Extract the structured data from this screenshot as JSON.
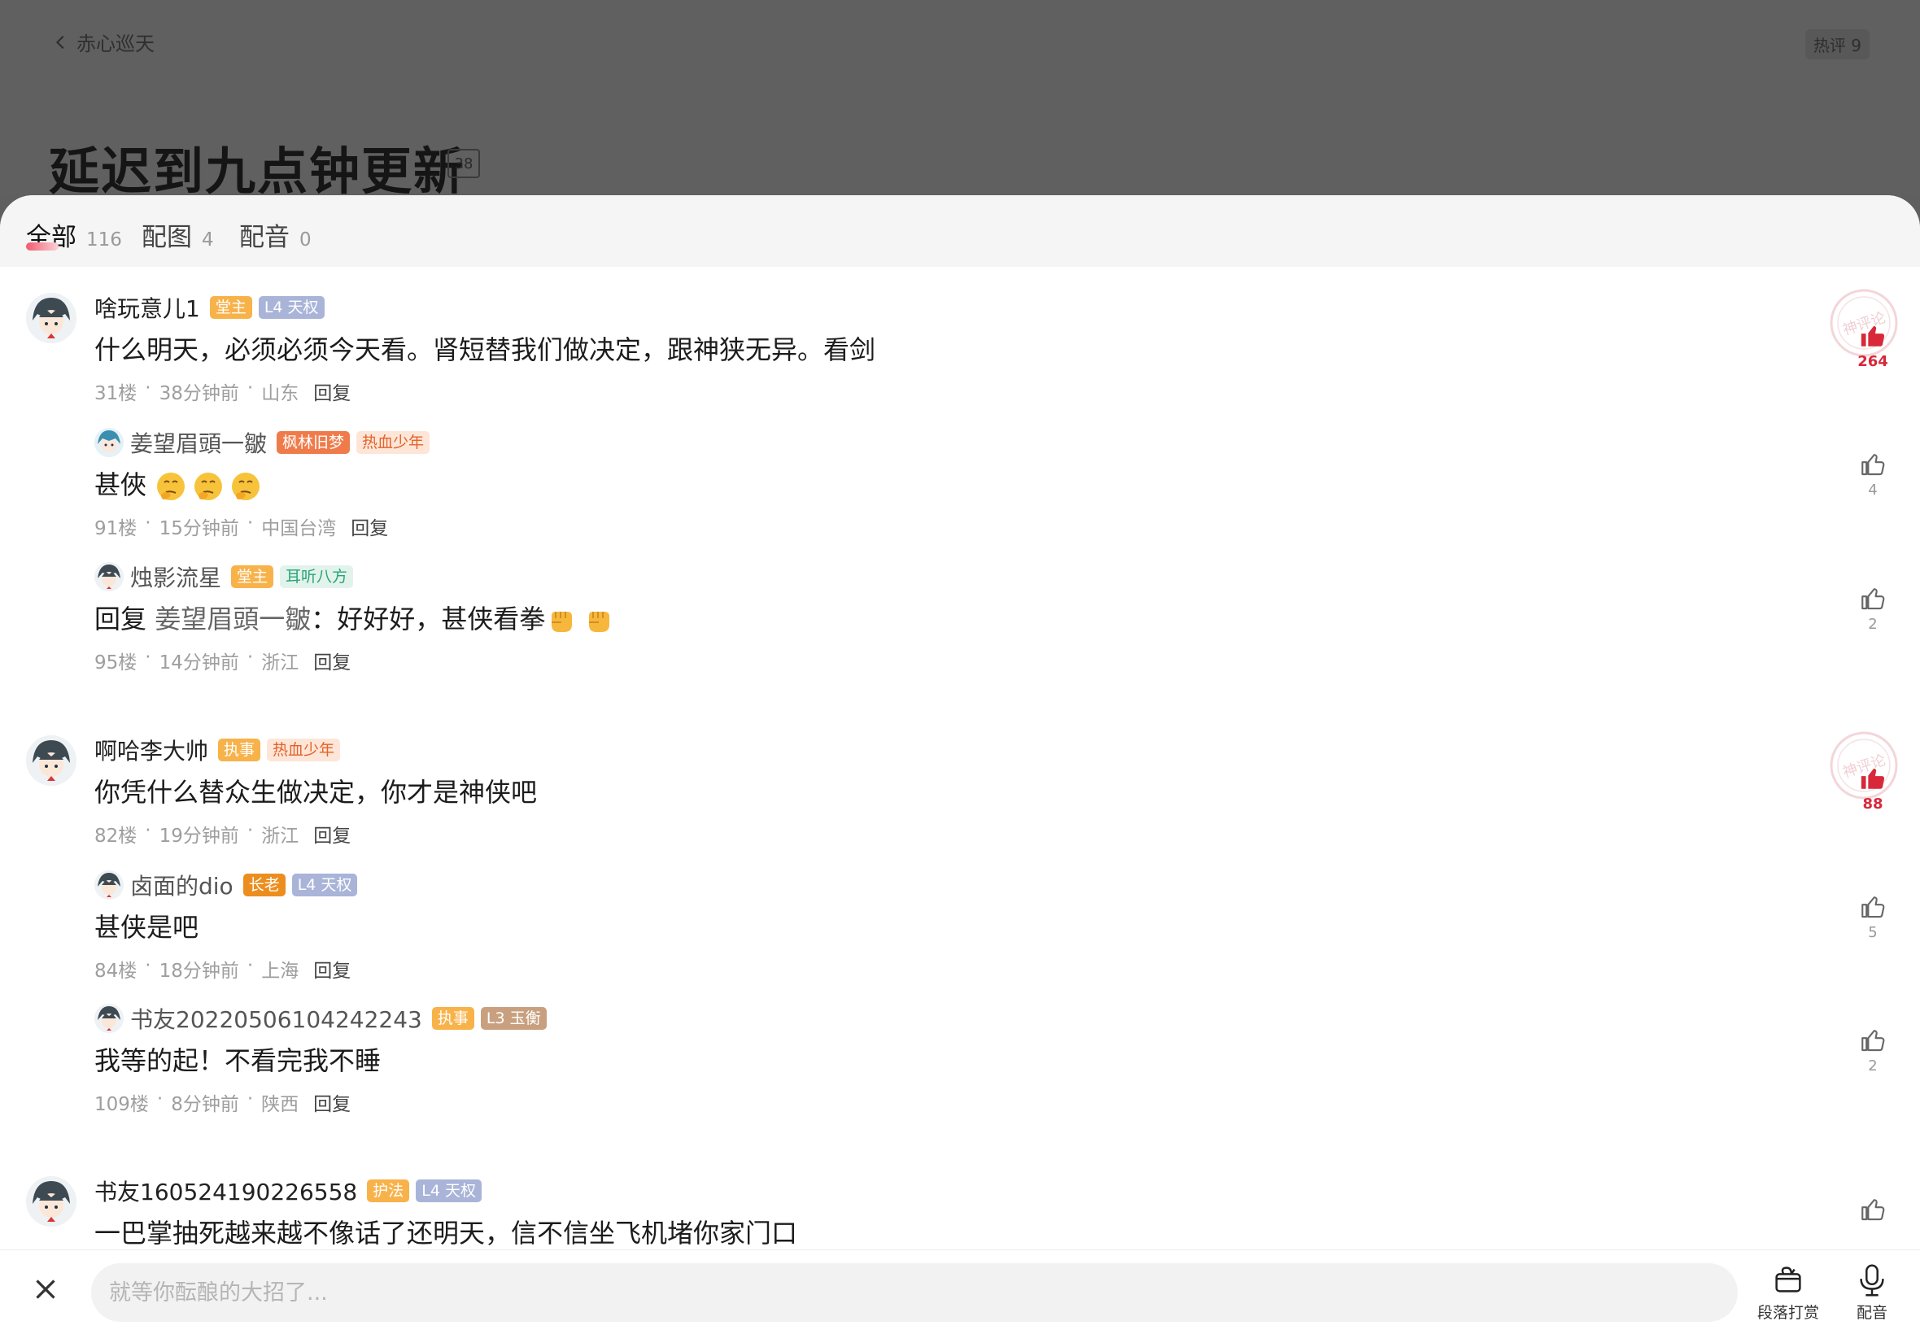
{
  "header": {
    "back_label": "赤心巡天",
    "hot_badge": "热评 9",
    "chapter_title": "延迟到九点钟更新",
    "chapter_comment_count": "38"
  },
  "tabs": [
    {
      "label": "全部",
      "count": "116",
      "active": true
    },
    {
      "label": "配图",
      "count": "4",
      "active": false
    },
    {
      "label": "配音",
      "count": "0",
      "active": false
    }
  ],
  "threads": [
    {
      "author": "啥玩意儿1",
      "badges": [
        "堂主",
        "L4 天权"
      ],
      "text": "什么明天，必须必须今天看。肾短替我们做决定，跟神狭无异。看剑",
      "floor": "31楼",
      "time": "38分钟前",
      "location": "山东",
      "reply_label": "回复",
      "likes": "264",
      "replies": [
        {
          "author": "姜望眉頭一皺",
          "badges": [
            "枫林旧梦",
            "热血少年"
          ],
          "text": "甚俠",
          "emojis": [
            "thinking",
            "thinking",
            "thinking"
          ],
          "floor": "91楼",
          "time": "15分钟前",
          "location": "中国台湾",
          "reply_label": "回复",
          "likes": "4"
        },
        {
          "author": "烛影流星",
          "badges": [
            "堂主",
            "耳听八方"
          ],
          "reply_prefix": "回复",
          "mention": "姜望眉頭一皺",
          "text": "：好好好，甚侠看拳",
          "emojis": [
            "fist",
            "fist"
          ],
          "floor": "95楼",
          "time": "14分钟前",
          "location": "浙江",
          "reply_label": "回复",
          "likes": "2"
        }
      ]
    },
    {
      "author": "啊哈李大帅",
      "badges": [
        "执事",
        "热血少年"
      ],
      "text": "你凭什么替众生做决定，你才是神侠吧",
      "floor": "82楼",
      "time": "19分钟前",
      "location": "浙江",
      "reply_label": "回复",
      "likes": "88",
      "replies": [
        {
          "author": "卤面的dio",
          "badges": [
            "长老",
            "L4 天权"
          ],
          "text": "甚侠是吧",
          "floor": "84楼",
          "time": "18分钟前",
          "location": "上海",
          "reply_label": "回复",
          "likes": "5"
        },
        {
          "author": "书友20220506104242243",
          "badges": [
            "执事",
            "L3 玉衡"
          ],
          "text": "我等的起！不看完我不睡",
          "floor": "109楼",
          "time": "8分钟前",
          "location": "陕西",
          "reply_label": "回复",
          "likes": "2"
        }
      ]
    },
    {
      "author": "书友160524190226558",
      "badges": [
        "护法",
        "L4 天权"
      ],
      "text": "一巴掌抽死越来越不像话了还明天，信不信坐飞机堵你家门口"
    }
  ],
  "seal_text": "神评论",
  "input": {
    "placeholder": "就等你酝酿的大招了..."
  },
  "tools": {
    "reward_label": "段落打赏",
    "dub_label": "配音"
  },
  "colors": {
    "accent_red": "#d8283a",
    "badge_orange": "#f8b24a",
    "badge_level": "#a9b4d8"
  }
}
